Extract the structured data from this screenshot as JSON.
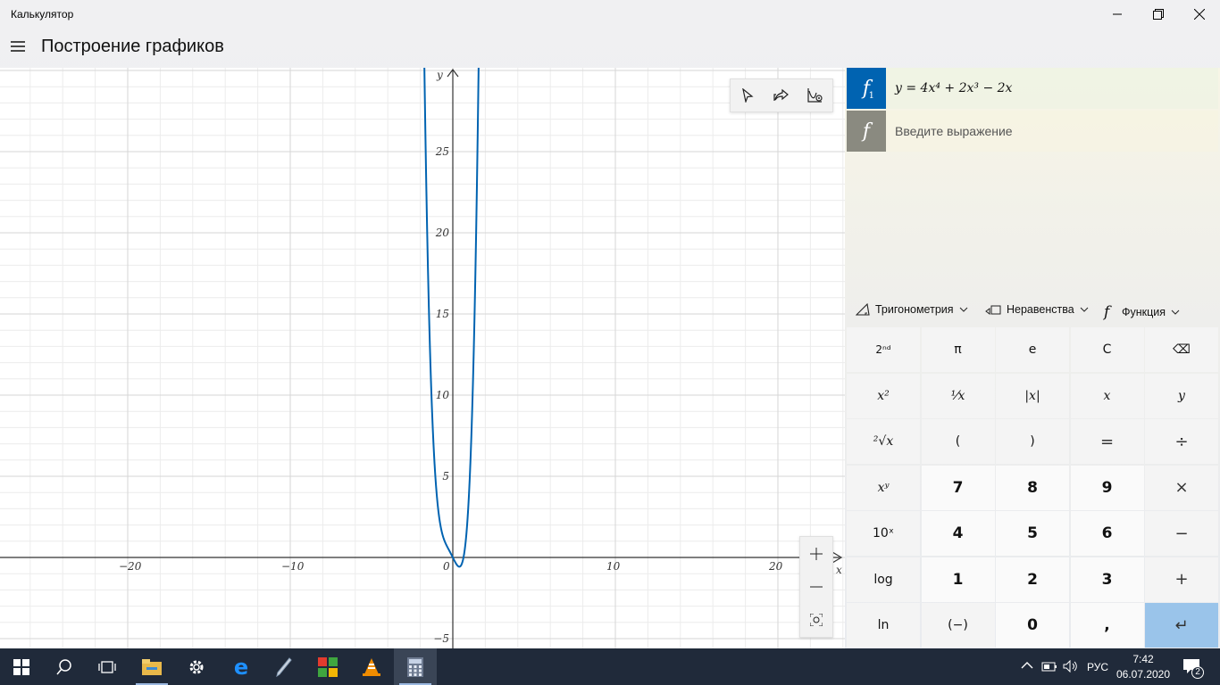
{
  "window": {
    "title": "Калькулятор",
    "minimize_icon": "minimize-icon",
    "restore_icon": "restore-icon",
    "close_icon": "close-icon"
  },
  "header": {
    "page_title": "Построение графиков",
    "menu_icon": "hamburger-icon"
  },
  "graph": {
    "x_axis_label": "x",
    "y_axis_label": "y",
    "x_ticks": [
      "−20",
      "−10",
      "0",
      "10",
      "20"
    ],
    "y_ticks": [
      "25",
      "20",
      "15",
      "10",
      "5",
      "−5"
    ],
    "toolbar": [
      "trace-icon",
      "share-icon",
      "graph-settings-icon"
    ],
    "zoom": {
      "in": "+",
      "out": "−",
      "fit": "fit-icon"
    }
  },
  "chart_data": {
    "type": "line",
    "function": "4x^4 + 2x^3 - 2x",
    "x_range": [
      -27,
      23
    ],
    "y_range": [
      -5,
      30
    ],
    "x_tick_values": [
      -20,
      -10,
      0,
      10,
      20
    ],
    "y_tick_values": [
      -5,
      5,
      10,
      15,
      20,
      25
    ],
    "grid": true,
    "series": [
      {
        "color": "#0063b1",
        "sample_x": [
          -1.7,
          -1.5,
          -1.25,
          -1,
          -0.75,
          -0.5,
          -0.25,
          0,
          0.25,
          0.5,
          0.75,
          1,
          1.2,
          1.4,
          1.6
        ],
        "sample_y": [
          25.9,
          13.5,
          5.2,
          4,
          1.9,
          1.0,
          0.49,
          0,
          -0.45,
          -0.5,
          0.5,
          4,
          10.2,
          21.3,
          39.9
        ]
      }
    ]
  },
  "functions": [
    {
      "label": "f",
      "index": "1",
      "expression": "y = 4x⁴ + 2x³ − 2x",
      "color": "#0063b1"
    },
    {
      "label": "f",
      "index": "",
      "placeholder": "Введите выражение",
      "color": "#8a8a80"
    }
  ],
  "categories": [
    {
      "icon": "triangle-icon",
      "label": "Тригонометрия"
    },
    {
      "icon": "inequality-icon",
      "label": "Неравенства"
    },
    {
      "icon": "function-icon",
      "label": "Функция"
    }
  ],
  "keypad": [
    [
      "2ⁿᵈ",
      "π",
      "e",
      "C",
      "⌫"
    ],
    [
      "x²",
      "¹⁄x",
      "|x|",
      "x",
      "y"
    ],
    [
      "²√x",
      "(",
      ")",
      "=",
      "÷"
    ],
    [
      "xʸ",
      "7",
      "8",
      "9",
      "×"
    ],
    [
      "10ˣ",
      "4",
      "5",
      "6",
      "−"
    ],
    [
      "log",
      "1",
      "2",
      "3",
      "+"
    ],
    [
      "ln",
      "(−)",
      "0",
      ",",
      "↵"
    ]
  ],
  "taskbar": {
    "apps": [
      "windows-start-icon",
      "search-icon",
      "task-view-icon",
      "file-explorer-icon",
      "settings-icon",
      "edge-icon",
      "pen-app-icon",
      "office-app-icon",
      "vlc-icon",
      "calculator-icon"
    ],
    "language": "РУС",
    "time": "7:42",
    "date": "06.07.2020",
    "notifications": "2"
  }
}
